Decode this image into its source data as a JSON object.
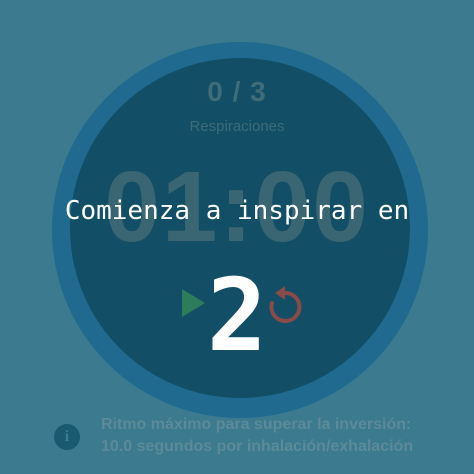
{
  "session": {
    "breath_count": "0 / 3",
    "breath_label": "Respiraciones",
    "timer": "01:00"
  },
  "controls": {
    "play_icon": "play-icon",
    "reset_icon": "reset-icon"
  },
  "info": {
    "icon": "info-icon",
    "text_line1": "Ritmo máximo para superar la inversión:",
    "text_line2": "10.0 segundos por inhalación/exhalación"
  },
  "countdown_overlay": {
    "title": "Comienza a inspirar en",
    "number": "2"
  },
  "colors": {
    "background": "#3b7a8f",
    "ring": "#1f6a8e",
    "circle": "#124f66",
    "play": "#2e7d5a",
    "reset": "#8a4a48",
    "overlay_text": "#ffffff"
  }
}
